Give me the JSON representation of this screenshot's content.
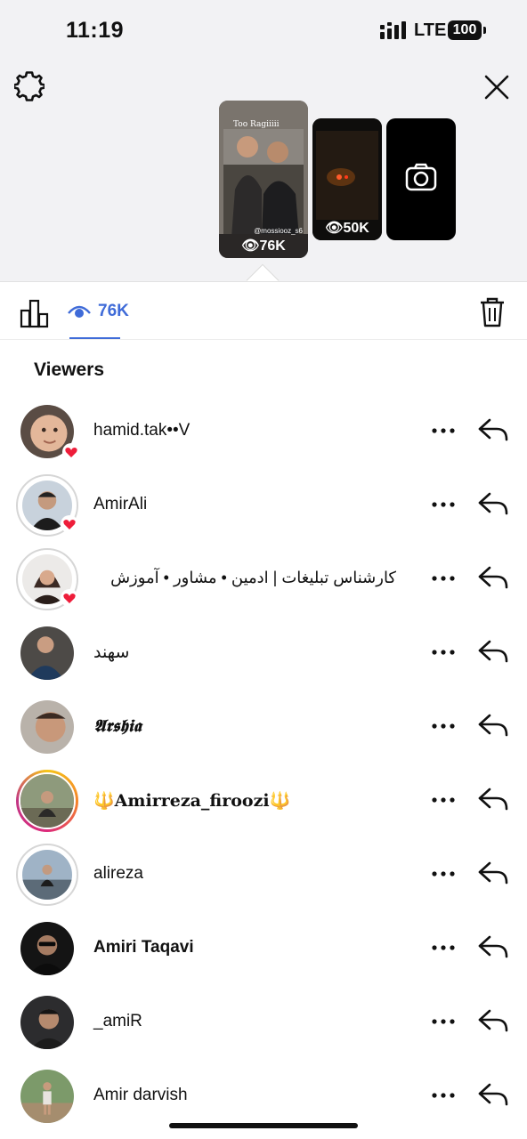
{
  "status": {
    "time": "11:19",
    "network": "LTE",
    "battery": "100"
  },
  "story_thumbs": [
    {
      "views": "76K",
      "caption": "Too Ragiiiii",
      "tag": "@mossiooz_s6"
    },
    {
      "views": "50K"
    },
    {
      "views": ""
    }
  ],
  "tabs": {
    "views_count": "76K"
  },
  "viewers": {
    "title": "Viewers",
    "list": [
      {
        "username": "hamid.tak••V"
      },
      {
        "username": "AmirAli"
      },
      {
        "username": "کارشناس تبلیغات | ادمین • مشاور • آموزش"
      },
      {
        "username": "سهند"
      },
      {
        "username": "𝕬𝖗𝖘𝖍𝖎𝖆"
      },
      {
        "username": "🔱Amirreza_firoozi🔱"
      },
      {
        "username": "alireza"
      },
      {
        "username": "Amiri Taqavi"
      },
      {
        "username": "_amiR"
      },
      {
        "username": "Amir darvish"
      }
    ]
  },
  "colors": {
    "accent": "#3f6bd8",
    "heart": "#ee1d3a"
  }
}
